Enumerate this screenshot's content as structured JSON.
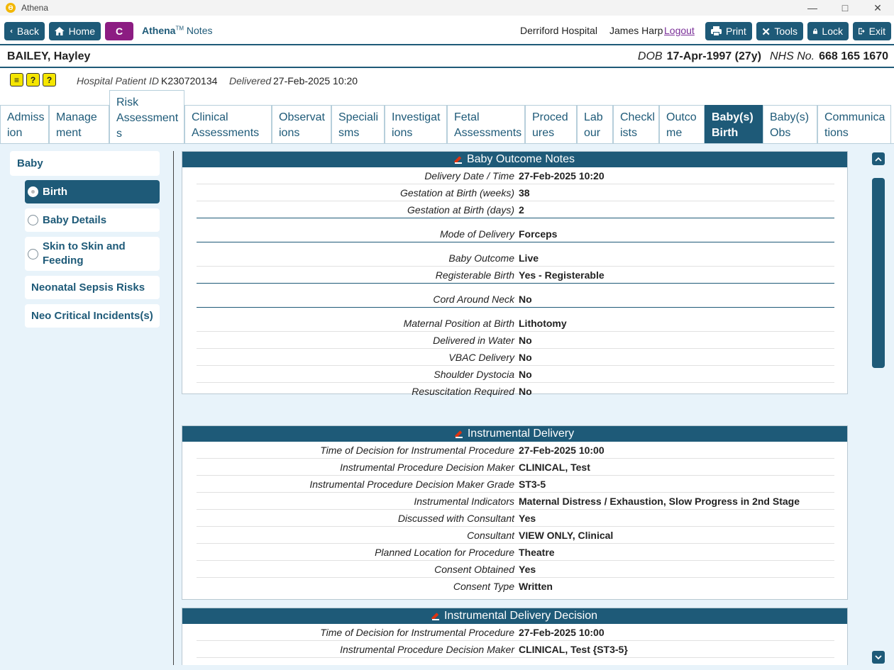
{
  "window": {
    "title": "Athena",
    "logo_glyph": "ϴ"
  },
  "toolbar": {
    "back_label": "Back",
    "home_label": "Home",
    "c_label": "C",
    "brand_bold": "Athena",
    "brand_tm": "TM",
    "brand_rest": " Notes",
    "hospital": "Derriford Hospital",
    "user": "James Harp",
    "logout_label": "Logout",
    "print_label": "Print",
    "tools_label": "Tools",
    "lock_label": "Lock",
    "exit_label": "Exit"
  },
  "patient": {
    "name": "BAILEY, Hayley",
    "dob_label": "DOB",
    "dob_value": "17-Apr-1997 (27y)",
    "nhs_label": "NHS No.",
    "nhs_value": "668 165 1670",
    "hospital_id_label": "Hospital Patient ID",
    "hospital_id_value": "K230720134",
    "delivered_label": "Delivered",
    "delivered_value": "27-Feb-2025 10:20"
  },
  "tabs": [
    {
      "label": "Admiss ion"
    },
    {
      "label": "Manage ment"
    },
    {
      "label": "Risk Assessment s"
    },
    {
      "label": "Clinical Assessments"
    },
    {
      "label": "Observat ions"
    },
    {
      "label": "Speciali sms"
    },
    {
      "label": "Investigat ions"
    },
    {
      "label": "Fetal Assessments"
    },
    {
      "label": "Proced ures"
    },
    {
      "label": "Lab our"
    },
    {
      "label": "Checkl ists"
    },
    {
      "label": "Outco me"
    },
    {
      "label": "Baby(s) Birth"
    },
    {
      "label": "Baby(s) Obs"
    },
    {
      "label": "Communica tions"
    }
  ],
  "sidebar": {
    "items": [
      {
        "label": "Baby"
      },
      {
        "label": "Birth"
      },
      {
        "label": "Baby Details"
      },
      {
        "label": "Skin to Skin and Feeding"
      },
      {
        "label": "Neonatal Sepsis Risks"
      },
      {
        "label": "Neo Critical Incidents(s)"
      }
    ]
  },
  "panels": {
    "outcome": {
      "title": "Baby Outcome Notes",
      "rows": [
        {
          "label": "Delivery Date / Time",
          "value": "27-Feb-2025 10:20"
        },
        {
          "label": "Gestation at Birth (weeks)",
          "value": "38"
        },
        {
          "label": "Gestation at Birth (days)",
          "value": "2"
        },
        {
          "label": "Mode of Delivery",
          "value": "Forceps"
        },
        {
          "label": "Baby Outcome",
          "value": "Live"
        },
        {
          "label": "Registerable Birth",
          "value": "Yes - Registerable"
        },
        {
          "label": "Cord Around Neck",
          "value": "No"
        },
        {
          "label": "Maternal Position at Birth",
          "value": "Lithotomy"
        },
        {
          "label": "Delivered in Water",
          "value": "No"
        },
        {
          "label": "VBAC Delivery",
          "value": "No"
        },
        {
          "label": "Shoulder Dystocia",
          "value": "No"
        },
        {
          "label": "Resuscitation Required",
          "value": "No"
        }
      ]
    },
    "instrumental": {
      "title": "Instrumental Delivery",
      "rows": [
        {
          "label": "Time of Decision for Instrumental Procedure",
          "value": "27-Feb-2025 10:00"
        },
        {
          "label": "Instrumental Procedure Decision Maker",
          "value": "CLINICAL, Test"
        },
        {
          "label": "Instrumental Procedure Decision Maker Grade",
          "value": "ST3-5"
        },
        {
          "label": "Instrumental Indicators",
          "value": "Maternal Distress / Exhaustion, Slow Progress in 2nd Stage"
        },
        {
          "label": "Discussed with Consultant",
          "value": "Yes"
        },
        {
          "label": "Consultant",
          "value": "VIEW ONLY, Clinical"
        },
        {
          "label": "Planned Location for Procedure",
          "value": "Theatre"
        },
        {
          "label": "Consent Obtained",
          "value": "Yes"
        },
        {
          "label": "Consent Type",
          "value": "Written"
        }
      ]
    },
    "decision": {
      "title": "Instrumental Delivery Decision",
      "rows": [
        {
          "label": "Time of Decision for Instrumental Procedure",
          "value": "27-Feb-2025 10:00"
        },
        {
          "label": "Instrumental Procedure Decision Maker",
          "value": "CLINICAL, Test {ST3-5}"
        }
      ]
    }
  },
  "colors": {
    "primary": "#1e5a78",
    "c_button": "#8c1c82",
    "panel_bg": "#e8f3fa",
    "logout": "#7a2f98",
    "alert_yellow": "#f5e600"
  }
}
